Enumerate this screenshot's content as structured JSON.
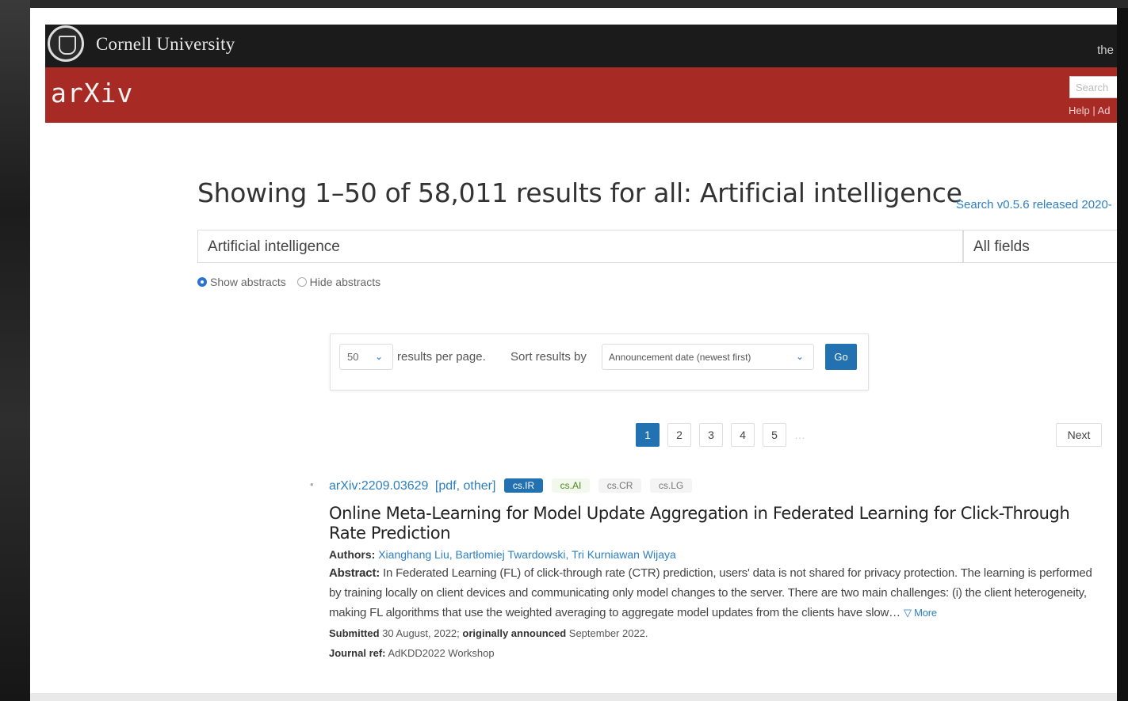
{
  "cornell": {
    "name": "Cornell University",
    "right_text": "the"
  },
  "header": {
    "logo": "arXiv",
    "search_placeholder": "Search",
    "links": "Help | Ad"
  },
  "main": {
    "title": "Showing 1–50 of 58,011 results for all: Artificial intelligence",
    "version_link": "Search v0.5.6 released 2020-",
    "query": "Artificial intelligence",
    "field": "All fields",
    "show_abstracts": "Show abstracts",
    "hide_abstracts": "Hide abstracts"
  },
  "options": {
    "size": "50",
    "results_per_page": "results per page.",
    "sort_label": "Sort results by",
    "sort_value": "Announcement date (newest first)",
    "go_label": "Go"
  },
  "pagination": {
    "pages": [
      "1",
      "2",
      "3",
      "4",
      "5"
    ],
    "current": "1",
    "ellipsis": "…",
    "next": "Next"
  },
  "result": {
    "arxiv_id": "arXiv:2209.03629",
    "links": "[pdf, other]",
    "tags": [
      {
        "label": "cs.IR",
        "kind": "primary"
      },
      {
        "label": "cs.AI",
        "kind": "ai"
      },
      {
        "label": "cs.CR",
        "kind": "sec"
      },
      {
        "label": "cs.LG",
        "kind": "sec"
      }
    ],
    "title": "Online Meta-Learning for Model Update Aggregation in Federated Learning for Click-Through Rate Prediction",
    "authors_label": "Authors:",
    "authors": [
      "Xianghang Liu,",
      "Bartłomiej Twardowski,",
      "Tri Kurniawan Wijaya"
    ],
    "abstract_label": "Abstract:",
    "abstract": "In Federated Learning (FL) of click-through rate (CTR) prediction, users' data is not shared for privacy protection. The learning is performed by training locally on client devices and communicating only model changes to the server. There are two main challenges: (i) the client heterogeneity, making FL algorithms that use the weighted averaging to aggregate model updates from the clients have slow…",
    "more": "▽ More",
    "submitted_label": "Submitted",
    "submitted": "30 August, 2022;",
    "announced_label": "originally announced",
    "announced": "September 2022.",
    "journal_label": "Journal ref:",
    "journal": "AdKDD2022 Workshop"
  }
}
